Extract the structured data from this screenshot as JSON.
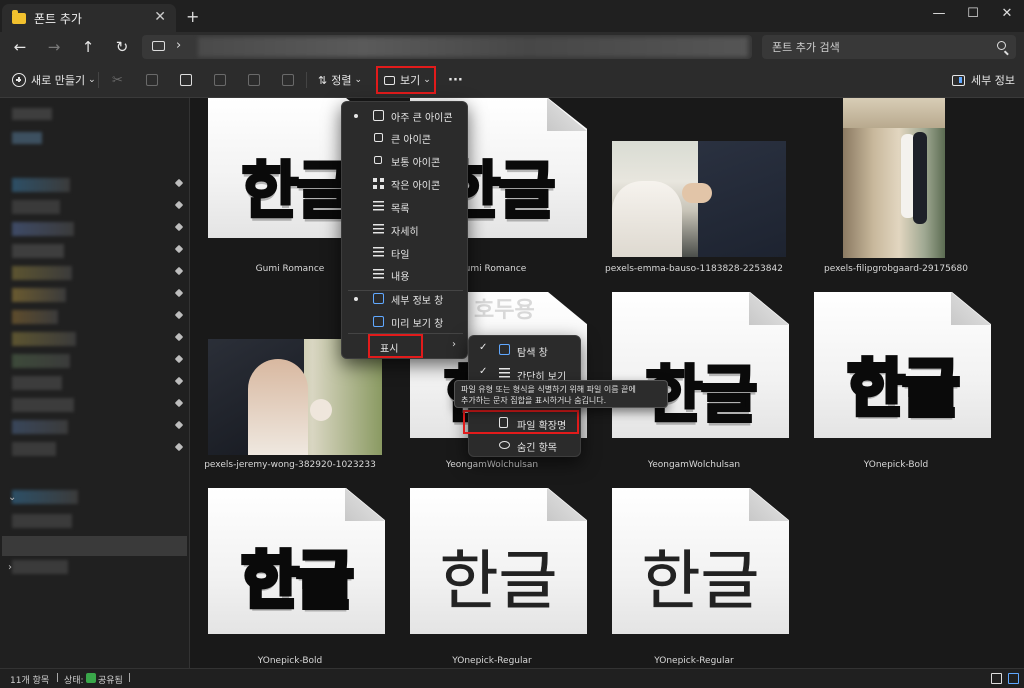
{
  "window": {
    "tab_title": "폰트 추가",
    "tab_close": "✕",
    "new_tab": "+",
    "minimize": "—",
    "maximize": "☐",
    "close": "✕"
  },
  "nav": {
    "back": "←",
    "forward": "→",
    "up": "↑",
    "refresh": "↻",
    "breadcrumb_sep": "›",
    "search_placeholder": "폰트 추가 검색"
  },
  "toolbar": {
    "new_label": "새로 만들기",
    "sort_label": "정렬",
    "view_label": "보기",
    "more_label": "···",
    "details_label": "세부 정보",
    "dropdown": "⌄"
  },
  "view_menu": {
    "items": [
      {
        "label": "아주 큰 아이콘",
        "selected": true
      },
      {
        "label": "큰 아이콘",
        "selected": false
      },
      {
        "label": "보통 아이콘",
        "selected": false
      },
      {
        "label": "작은 아이콘",
        "selected": false
      },
      {
        "label": "목록",
        "selected": false
      },
      {
        "label": "자세히",
        "selected": false
      },
      {
        "label": "타일",
        "selected": false
      },
      {
        "label": "내용",
        "selected": false
      },
      {
        "label": "세부 정보 창",
        "selected": true
      },
      {
        "label": "미리 보기 창",
        "selected": false
      }
    ],
    "show_label": "표시",
    "show_arrow": "›"
  },
  "show_submenu": {
    "items": [
      {
        "label": "탐색 창",
        "checked": true
      },
      {
        "label": "간단히 보기",
        "checked": true
      },
      {
        "label": "파일 확장명",
        "checked": false
      },
      {
        "label": "숨긴 항목",
        "checked": false
      }
    ],
    "check": "✓"
  },
  "tooltip": {
    "line1": "파일 유형 또는 형식을 식별하기 위해 파일 이름 끝에",
    "line2": "추가하는 문자 집합을 표시하거나 숨깁니다."
  },
  "watermark": "호두용",
  "files": [
    {
      "name": "Gumi Romance",
      "kind": "font",
      "glyph": "한글",
      "style": "bold"
    },
    {
      "name": "Gumi Romance",
      "kind": "font",
      "glyph": "한글",
      "style": "bold"
    },
    {
      "name": "pexels-emma-bauso-1183828-2253842",
      "kind": "photo"
    },
    {
      "name": "pexels-filipgrobgaard-29175680",
      "kind": "photo"
    },
    {
      "name": "pexels-jeremy-wong-382920-1023233",
      "kind": "photo"
    },
    {
      "name": "YeongamWolchulsan",
      "kind": "font",
      "glyph": "한글",
      "style": "bold"
    },
    {
      "name": "YeongamWolchulsan",
      "kind": "font",
      "glyph": "한글",
      "style": "bold"
    },
    {
      "name": "YOnepick-Bold",
      "kind": "font",
      "glyph": "한글",
      "style": "bold"
    },
    {
      "name": "YOnepick-Bold",
      "kind": "font",
      "glyph": "한글",
      "style": "bold"
    },
    {
      "name": "YOnepick-Regular",
      "kind": "font",
      "glyph": "한글",
      "style": "regular"
    },
    {
      "name": "YOnepick-Regular",
      "kind": "font",
      "glyph": "한글",
      "style": "regular"
    }
  ],
  "status": {
    "count": "11개 항목",
    "sep": "|",
    "state_label": "상태:",
    "shared": "공유됨"
  },
  "colors": {
    "highlight": "#e21b1b",
    "accent": "#60a8ff",
    "background": "#191919"
  }
}
